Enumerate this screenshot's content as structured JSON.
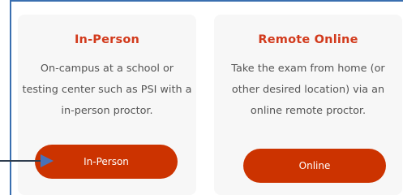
{
  "cards": [
    {
      "title": "In-Person",
      "lines": [
        "On-campus at a school or",
        "testing center such as PSI with a",
        "in-person proctor."
      ],
      "button_label": "In-Person"
    },
    {
      "title": "Remote Online",
      "lines": [
        "Take the exam from home (or",
        "other desired location) via an",
        "online remote proctor."
      ],
      "button_label": "Online"
    }
  ],
  "colors": {
    "accent": "#cc3300",
    "title": "#d23a1c",
    "card_bg": "#f7f7f7",
    "frame": "#3a6fb0"
  }
}
